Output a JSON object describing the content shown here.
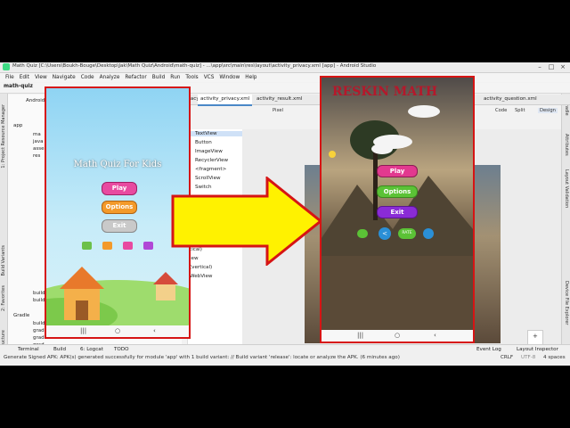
{
  "window": {
    "title": "Math Quiz [C:\\Users\\Boukh-Bouge\\Desktop\\Jak\\Math Quiz\\Android\\math-quiz] - ...\\app\\src\\main\\res\\layout\\activity_privacy.xml [app] - Android Studio"
  },
  "menu": [
    "File",
    "Edit",
    "View",
    "Navigate",
    "Code",
    "Analyze",
    "Refactor",
    "Build",
    "Run",
    "Tools",
    "VCS",
    "Window",
    "Help"
  ],
  "breadcrumb": {
    "project": "math-quiz"
  },
  "tabs": [
    {
      "label": "ivacy.xml",
      "active": false
    },
    {
      "label": "activity_privacy.xml",
      "active": true
    },
    {
      "label": "activity_result.xml",
      "active": false
    },
    {
      "label": "activity_question.xml",
      "active": false
    }
  ],
  "view_modes": [
    "Code",
    "Split",
    "Design"
  ],
  "device_selector": "Pixel",
  "tree": {
    "items": [
      "app",
      "ma",
      "java",
      "asse",
      "res",
      "build",
      "build",
      "Gradle",
      "build",
      "grad",
      "grad",
      "grad",
      "grad",
      "settings.gradle (Project Settings)"
    ],
    "android_label": "Android"
  },
  "palette": {
    "items": [
      "TextView",
      "Button",
      "ImageView",
      "RecyclerView",
      "<fragment>",
      "ScrollView",
      "Switch"
    ],
    "lower_items": [
      "(vertical)",
      "tical)",
      "iew",
      "(vertical)",
      "WebView"
    ]
  },
  "side_labels": {
    "left": [
      "Resource Manager",
      "1: Project",
      "Build Variants",
      "2: Favorites",
      "Z: Structure"
    ],
    "right": [
      "Gradle",
      "Attributes",
      "Layout Validation",
      "Device File Explorer"
    ]
  },
  "bottom_tabs": [
    "Terminal",
    "Build",
    "6: Logcat",
    "TODO"
  ],
  "bottom_right_tabs": [
    "Event Log",
    "Layout Inspector"
  ],
  "status": {
    "message": "Generate Signed APK: APK(s) generated successfully for module 'app' with 1 build variant: // Build variant 'release': locate or analyze the APK. (6 minutes ago)",
    "line_sep": "CRLF",
    "encoding": "UTF-8",
    "indent": "4 spaces"
  },
  "phone_before": {
    "title": "Math Quiz For Kids",
    "buttons": [
      "Play",
      "Options",
      "Exit"
    ],
    "nav": [
      "|||",
      "○",
      "‹"
    ]
  },
  "phone_after": {
    "title": "RESKIN MATH",
    "buttons": [
      "Play",
      "Options",
      "Exit"
    ],
    "icon_label": "RATE",
    "nav": [
      "|||",
      "○",
      "‹"
    ]
  },
  "colors": {
    "highlight_border": "#d61414",
    "arrow_fill": "#fff200",
    "arrow_stroke": "#d61414",
    "play_btn": "#e2398f",
    "options_btn": "#5bc236",
    "exit_btn": "#8a2bd6"
  }
}
